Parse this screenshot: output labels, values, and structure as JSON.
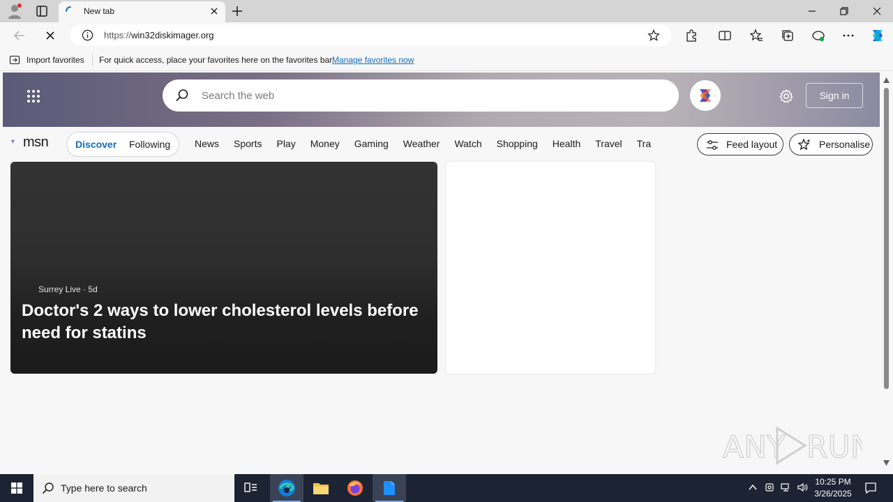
{
  "browser": {
    "tab_title": "New tab",
    "url_scheme": "https://",
    "url_host": "win32diskimager.org"
  },
  "favorites_bar": {
    "import_label": "Import favorites",
    "message": "For quick access, place your favorites here on the favorites bar.",
    "manage_link": "Manage favorites now"
  },
  "msn": {
    "search_placeholder": "Search the web",
    "sign_in": "Sign in",
    "logo_text": "msn",
    "segments": {
      "discover": "Discover",
      "following": "Following"
    },
    "nav_links": [
      "News",
      "Sports",
      "Play",
      "Money",
      "Gaming",
      "Weather",
      "Watch",
      "Shopping",
      "Health",
      "Travel",
      "Tra"
    ],
    "feed_layout": "Feed layout",
    "personalise": "Personalise",
    "accent_color": "#0f6cbd"
  },
  "card": {
    "source": "Surrey Live",
    "age": "5d",
    "title": "Doctor's 2 ways to lower cholesterol levels before need for statins"
  },
  "watermark": "ANY RUN",
  "taskbar": {
    "search_text": "Type here to search",
    "time": "10:25 PM",
    "date": "3/26/2025"
  }
}
